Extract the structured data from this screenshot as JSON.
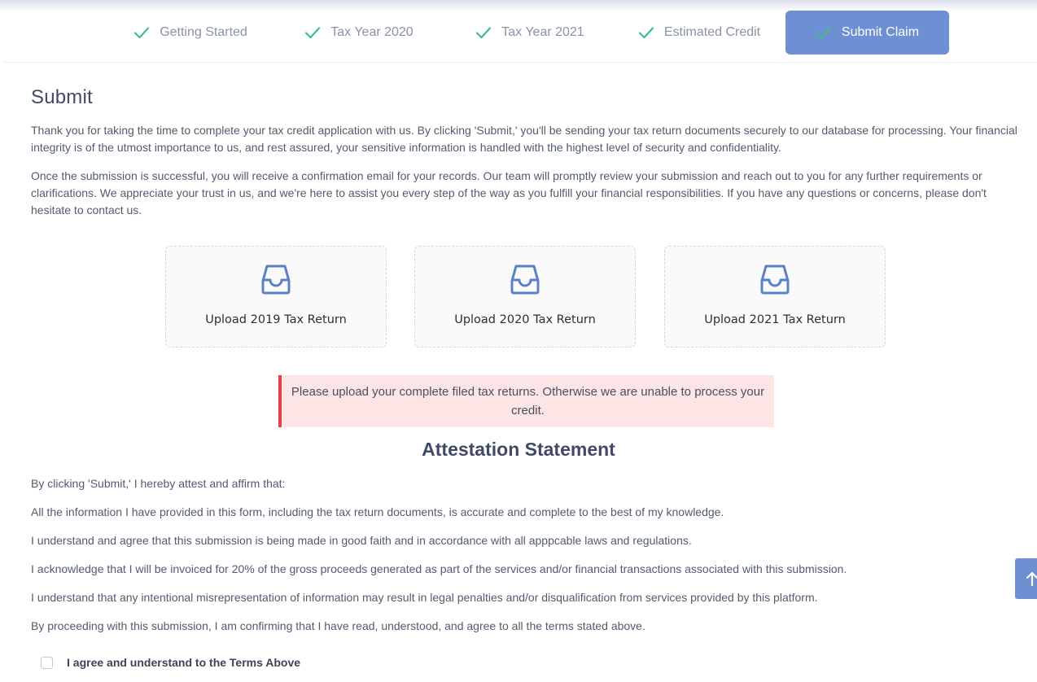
{
  "stepper": {
    "steps": [
      {
        "label": "Getting Started",
        "completed": true
      },
      {
        "label": "Tax Year 2020",
        "completed": true
      },
      {
        "label": "Tax Year 2021",
        "completed": true
      },
      {
        "label": "Estimated Credit",
        "completed": true
      },
      {
        "label": "Submit Claim",
        "completed": true,
        "active": true
      }
    ],
    "check_icon": "check-icon",
    "check_color": "#3dbf8a",
    "active_color": "#6f8fd3"
  },
  "submit": {
    "title": "Submit",
    "paragraph_1": "Thank you for taking the time to complete your tax credit application with us. By clicking 'Submit,' you'll be sending your tax return documents securely to our database for processing. Your financial integrity is of the utmost importance to us, and rest assured, your sensitive information is handled with the highest level of security and confidentiality.",
    "paragraph_2": "Once the submission is successful, you will receive a confirmation email for your records. Our team will promptly review your submission and reach out to you for any further requirements or clarifications. We appreciate your trust in us, and we're here to assist you every step of the way as you fulfill your financial responsibilities. If you have any questions or concerns, please don't hesitate to contact us."
  },
  "uploads": [
    {
      "label": "Upload 2019 Tax Return",
      "icon": "inbox-icon"
    },
    {
      "label": "Upload 2020 Tax Return",
      "icon": "inbox-icon"
    },
    {
      "label": "Upload 2021 Tax Return",
      "icon": "inbox-icon"
    }
  ],
  "alert": {
    "text": "Please upload your complete filed tax returns. Otherwise we are unable to process your credit.",
    "accent_color": "#e3424b"
  },
  "attestation": {
    "title": "Attestation Statement",
    "lines": [
      "By clicking 'Submit,' I hereby attest and affirm that:",
      "All the information I have provided in this form, including the tax return documents, is accurate and complete to the best of my knowledge.",
      "I understand and agree that this submission is being made in good faith and in accordance with all apppcable laws and regulations.",
      "I acknowledge that I will be invoiced for 20% of the gross proceeds generated as part of the services and/or financial transactions associated with this submission.",
      "I understand that any intentional misrepresentation of information may result in legal penalties and/or disqualification from services provided by this platform.",
      "By proceeding with this submission, I am confirming that I have read, understood, and agree to all the terms stated above."
    ],
    "agree_label": "I agree and understand to the Terms Above",
    "agree_checked": false
  },
  "scroll_top": {
    "icon": "arrow-up-icon"
  }
}
